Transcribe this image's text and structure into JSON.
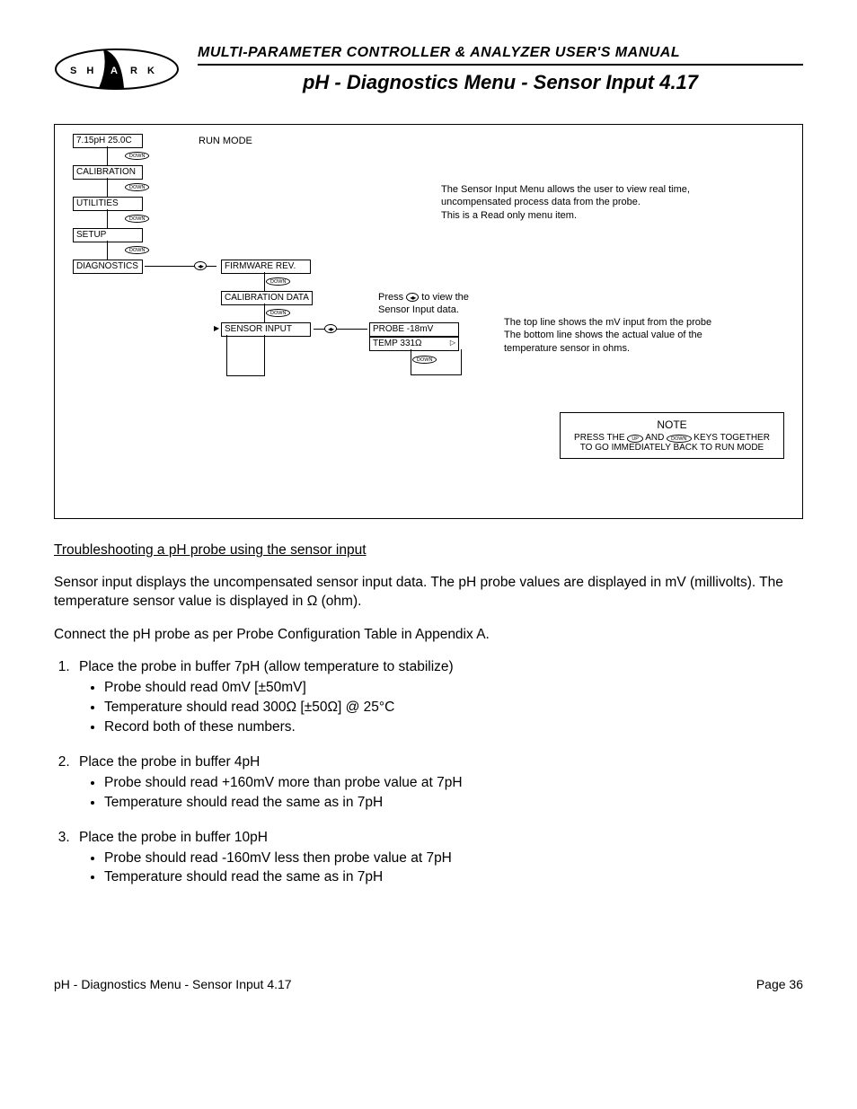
{
  "header": {
    "logo_letters": "S H A R K",
    "manual_title": "MULTI-PARAMETER CONTROLLER & ANALYZER USER'S MANUAL",
    "page_title": "pH - Diagnostics Menu - Sensor Input 4.17"
  },
  "diagram": {
    "run_mode_label": "RUN MODE",
    "down_label": "DOWN",
    "up_label": "UP",
    "lr_glyph": "◂▸",
    "tri_right": "▷",
    "menus": {
      "reading": "7.15pH  25.0C",
      "calibration": "CALIBRATION",
      "utilities": "UTILITIES",
      "setup": "SETUP",
      "diagnostics": "DIAGNOSTICS",
      "firmware": "FIRMWARE REV.",
      "cal_data": "CALIBRATION DATA",
      "sensor_input": "SENSOR INPUT",
      "probe": "PROBE  -18mV",
      "temp": "TEMP   331Ω"
    },
    "desc1": "The Sensor Input Menu allows the user to view real time, uncompensated process data from the probe.",
    "desc1b": "This is a Read only menu item.",
    "press_a": "Press ",
    "press_b": " to view the Sensor Input data.",
    "desc2a": "The top line shows the mV input from the probe",
    "desc2b": "The bottom line shows the actual value of the temperature sensor in ohms.",
    "note": {
      "title": "NOTE",
      "line_a": "PRESS THE ",
      "line_mid": " AND ",
      "line_b": " KEYS TOGETHER TO GO IMMEDIATELY BACK TO RUN MODE"
    }
  },
  "body": {
    "ts_heading": "Troubleshooting a pH probe using the sensor input",
    "p1": "Sensor input displays the uncompensated sensor input data. The pH probe values are displayed in mV (millivolts). The temperature sensor value is displayed in Ω (ohm).",
    "p2": "Connect the pH probe as per Probe Configuration Table in Appendix A.",
    "steps": [
      {
        "title": "Place the probe in buffer 7pH (allow temperature to stabilize)",
        "bullets": [
          "Probe should read 0mV [±50mV]",
          "Temperature should read 300Ω [±50Ω] @ 25°C",
          "Record both of these numbers."
        ]
      },
      {
        "title": "Place the probe in buffer 4pH",
        "bullets": [
          "Probe should read +160mV more than probe value at 7pH",
          "Temperature should read the same as in 7pH"
        ]
      },
      {
        "title": "Place the probe in buffer 10pH",
        "bullets": [
          "Probe should read -160mV less then probe value at 7pH",
          "Temperature should read the same as in 7pH"
        ]
      }
    ]
  },
  "footer": {
    "left": "pH - Diagnostics Menu - Sensor Input 4.17",
    "right": "Page 36"
  }
}
